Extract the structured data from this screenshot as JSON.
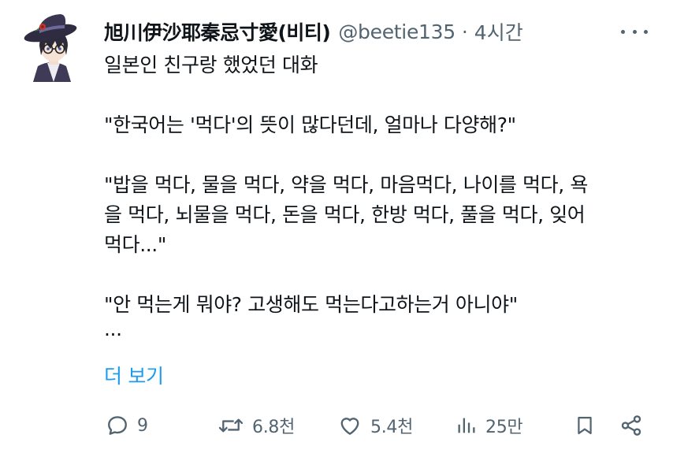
{
  "user": {
    "display_name": "旭川伊沙耶秦忌寸愛(비티)",
    "handle": "@beetie135",
    "separator": "·",
    "time": "4시간"
  },
  "tweet": {
    "lines": [
      "일본인 친구랑 했었던 대화",
      "",
      "\"한국어는 '먹다'의 뜻이 많다던데, 얼마나 다양해?\"",
      "",
      "\"밥을 먹다, 물을 먹다, 약을 먹다, 마음먹다, 나이를 먹다, 욕",
      "을 먹다, 뇌물을 먹다, 돈을 먹다, 한방 먹다, 풀을 먹다, 잊어",
      "먹다...\"",
      "",
      "\"안 먹는게 뭐야? 고생해도 먹는다고하는거 아니야\"",
      "..."
    ],
    "show_more": "더 보기"
  },
  "actions": {
    "replies": "9",
    "retweets": "6.8천",
    "likes": "5.4천",
    "views": "25만"
  },
  "icons": {
    "more": "more-horizontal-icon",
    "reply": "reply-bubble-icon",
    "retweet": "retweet-icon",
    "like": "heart-icon",
    "views": "analytics-bars-icon",
    "bookmark": "bookmark-icon",
    "share": "share-icon"
  },
  "colors": {
    "text": "#0f1419",
    "secondary": "#536471",
    "link": "#1d9bf0",
    "background": "#ffffff"
  }
}
